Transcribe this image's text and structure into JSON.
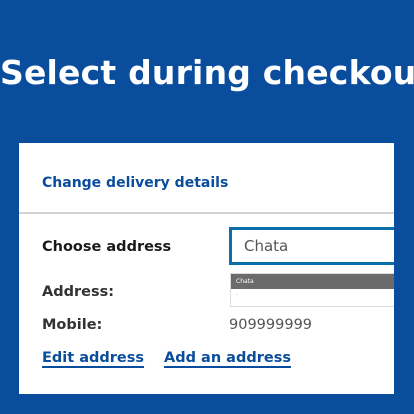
{
  "banner": {
    "headline": "Select during checkout"
  },
  "card": {
    "title": "Change delivery details",
    "choose_address": {
      "label": "Choose address",
      "input_value": "Chata",
      "suggestions": [
        {
          "primary": "Chata",
          "secondary": "."
        }
      ]
    },
    "address": {
      "label": "Address:"
    },
    "mobile": {
      "label": "Mobile:",
      "value": "909999999"
    },
    "links": {
      "edit_address": "Edit address",
      "add_address": "Add an address"
    }
  },
  "colors": {
    "background": "#0a4d9c",
    "accent_link": "#0a4d9c",
    "input_focus_border": "#0a6eab",
    "suggestion_highlight": "#6b6b6b"
  }
}
